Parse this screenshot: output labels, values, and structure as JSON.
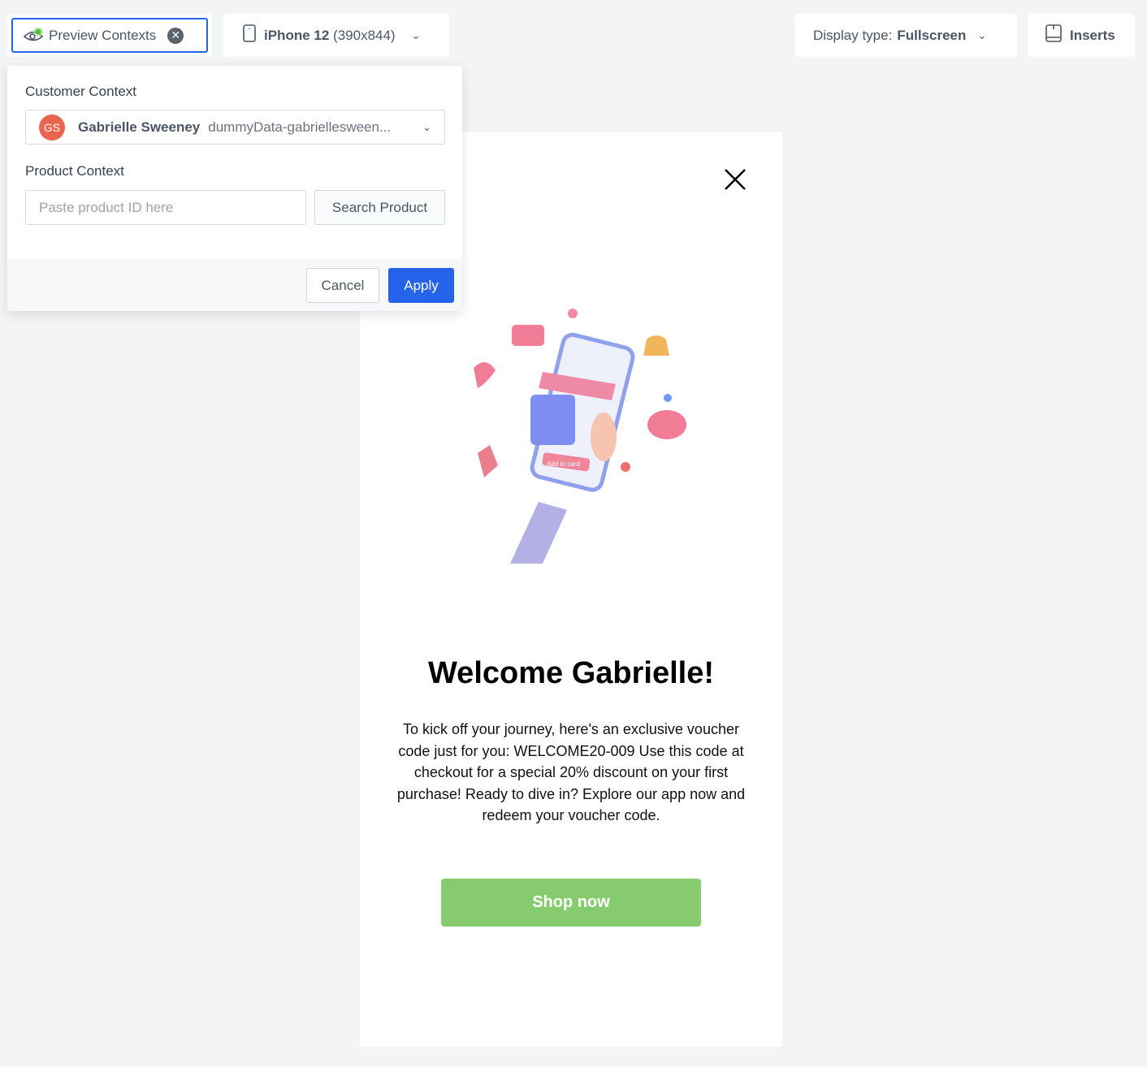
{
  "toolbar": {
    "preview_label": "Preview Contexts",
    "device_name": "iPhone 12",
    "device_size": "(390x844)",
    "display_type_label": "Display type:",
    "display_type_value": "Fullscreen",
    "inserts_label": "Inserts"
  },
  "panel": {
    "customer_label": "Customer Context",
    "customer": {
      "initials": "GS",
      "name": "Gabrielle Sweeney",
      "id": "dummyData-gabriellesween..."
    },
    "product_label": "Product Context",
    "product_placeholder": "Paste product ID here",
    "product_value": "",
    "search_label": "Search Product",
    "cancel_label": "Cancel",
    "apply_label": "Apply"
  },
  "preview": {
    "illustration_text": "Add to card",
    "title": "Welcome Gabrielle!",
    "body": "To kick off your journey, here's an exclusive voucher code just for you: WELCOME20-009 Use this code at checkout for a special 20% discount on your first purchase! Ready to dive in? Explore our app now and redeem your voucher code.",
    "cta": "Shop now"
  },
  "colors": {
    "accent": "#2563eb",
    "avatar": "#e9654f",
    "cta": "#86cc6e"
  }
}
